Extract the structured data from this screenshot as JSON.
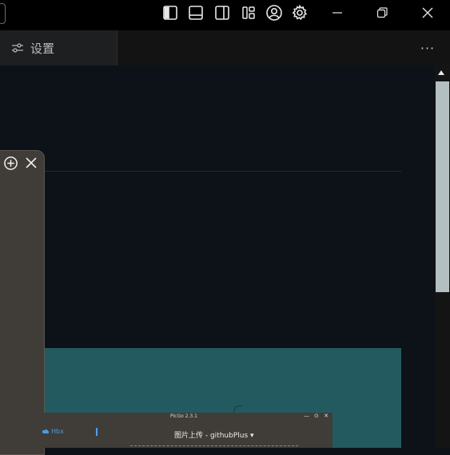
{
  "titlebar": {
    "icons": [
      "toggle-primary-sidebar-icon",
      "toggle-panel-icon",
      "toggle-secondary-sidebar-icon",
      "customize-layout-icon",
      "account-icon",
      "manage-gear-icon"
    ],
    "window_controls": [
      "minimize-icon",
      "restore-icon",
      "close-icon"
    ]
  },
  "tab": {
    "label": "设置",
    "icon": "settings-sliders-icon"
  },
  "tabbar": {
    "more_label": "···"
  },
  "inner_window": {
    "title": "PicGo 2.3.1",
    "controls": "— ⊙ ✕",
    "side_label": "Hbx",
    "upload_label": "图片上传 - githubPlus ▾"
  },
  "colors": {
    "background": "#0d1118",
    "titlebar": "#000000",
    "tab_active": "#1e1f20",
    "scroll_thumb": "#b3bfc1",
    "panel": "#403c38",
    "image_teal": "#235a5f"
  }
}
